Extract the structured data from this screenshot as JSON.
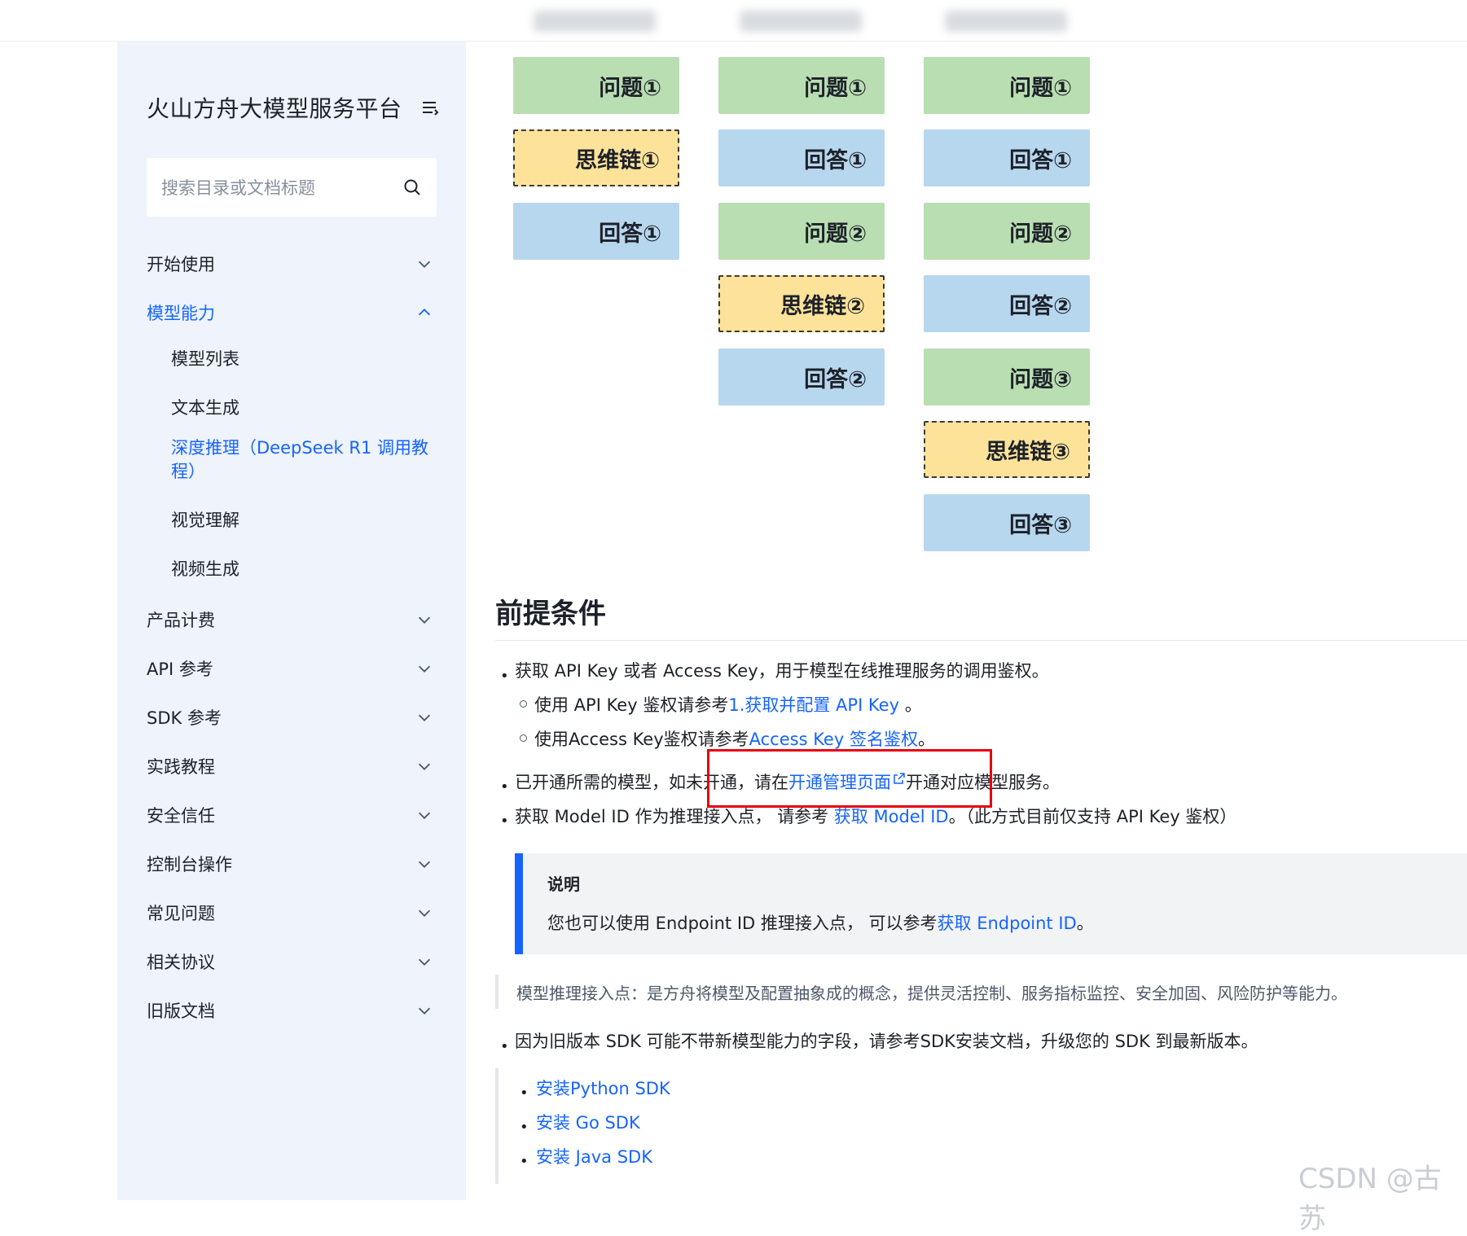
{
  "sidebar": {
    "brand": "火山方舟大模型服务平台",
    "search_placeholder": "搜索目录或文档标题",
    "items": [
      {
        "label": "开始使用"
      },
      {
        "label": "模型能力"
      },
      {
        "label": "产品计费"
      },
      {
        "label": "API 参考"
      },
      {
        "label": "SDK 参考"
      },
      {
        "label": "实践教程"
      },
      {
        "label": "安全信任"
      },
      {
        "label": "控制台操作"
      },
      {
        "label": "常见问题"
      },
      {
        "label": "相关协议"
      },
      {
        "label": "旧版文档"
      }
    ],
    "sub_items": [
      {
        "label": "模型列表"
      },
      {
        "label": "文本生成"
      },
      {
        "label": "深度推理（DeepSeek R1 调用教程）"
      },
      {
        "label": "视觉理解"
      },
      {
        "label": "视频生成"
      }
    ]
  },
  "diagram": {
    "col1": [
      "问题①",
      "思维链①",
      "回答①"
    ],
    "col2": [
      "问题①",
      "回答①",
      "问题②",
      "思维链②",
      "回答②"
    ],
    "col3": [
      "问题①",
      "回答①",
      "问题②",
      "回答②",
      "问题③",
      "思维链③",
      "回答③"
    ]
  },
  "content": {
    "heading": "前提条件",
    "b1": "获取 API Key 或者 Access Key，用于模型在线推理服务的调用鉴权。",
    "b1a_pre": "使用 API Key 鉴权请参考",
    "b1a_link": "1.获取并配置 API Key",
    "b1a_post": " 。",
    "b1b_pre": "使用Access Key鉴权请参考",
    "b1b_link1": "Access Key ",
    "b1b_link2": "签名鉴权",
    "b1b_post": "。",
    "b2_pre": "已开通所需的模型，如未开通，请在",
    "b2_link": "开通管理页面",
    "b2_post": "开通对应模型服务。",
    "b3_pre": "获取 Model ID 作为推理接入点， 请参考 ",
    "b3_link": "获取 Model ID",
    "b3_post": "。（此方式目前仅支持 API Key 鉴权）",
    "note_title": "说明",
    "note_pre": "您也可以使用 Endpoint ID 推理接入点， 可以参考",
    "note_link": "获取 Endpoint ID",
    "note_post": "。",
    "quote": "模型推理接入点：是方舟将模型及配置抽象成的概念，提供灵活控制、服务指标监控、安全加固、风险防护等能力。",
    "b4": "因为旧版本 SDK 可能不带新模型能力的字段，请参考SDK安装文档，升级您的 SDK 到最新版本。",
    "sdk_links": [
      "安装Python SDK",
      "安装 Go SDK",
      "安装 Java SDK"
    ]
  },
  "watermark": "CSDN @古苏",
  "colors": {
    "accent": "#1664ff",
    "highlight": "#e60012",
    "question": "#b9deb2",
    "answer": "#b7d7ee",
    "chain": "#fde39a"
  }
}
